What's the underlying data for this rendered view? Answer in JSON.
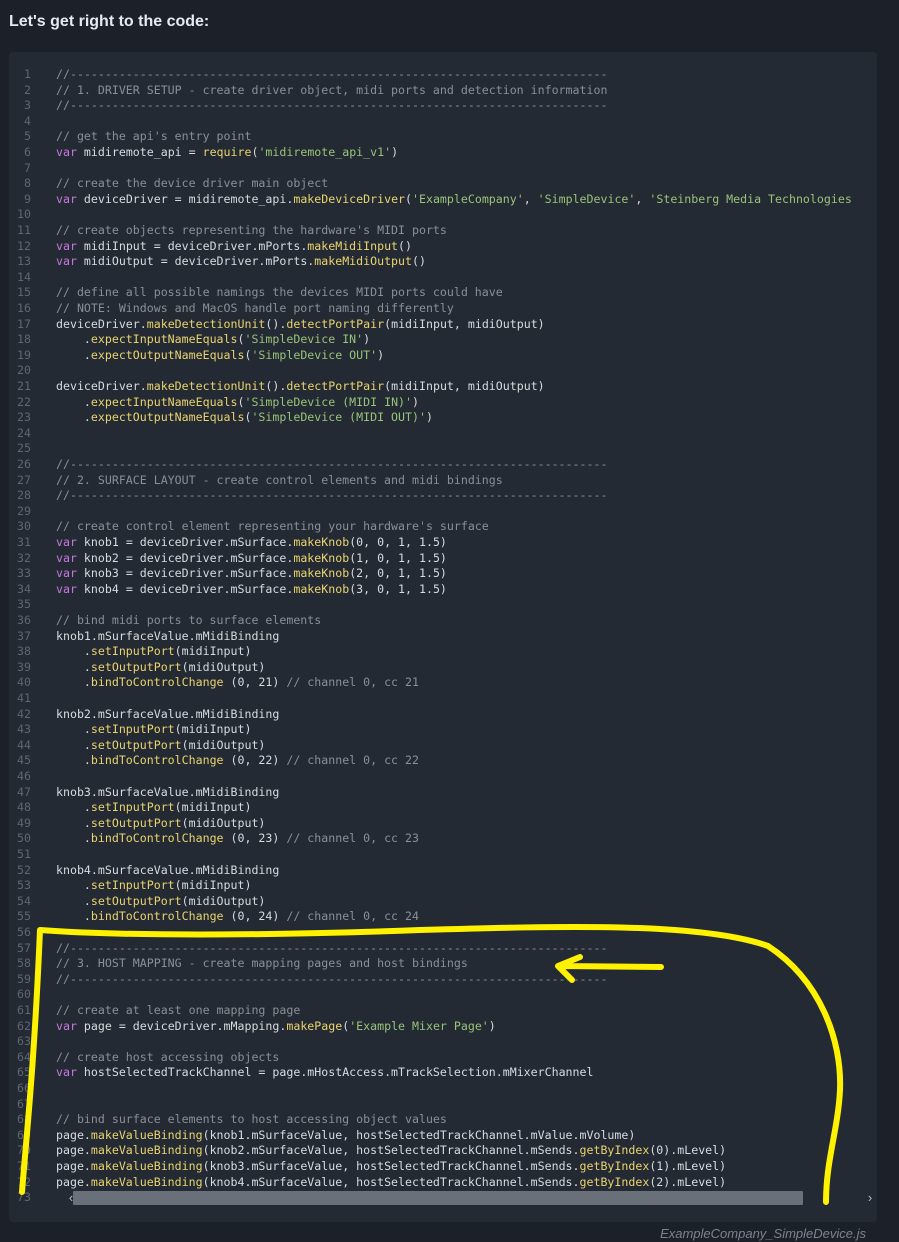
{
  "heading": "Let's get right to the code:",
  "filename": "ExampleCompany_SimpleDevice.js",
  "colors": {
    "background": "#1c2129",
    "code_background": "#242a33",
    "annotation_yellow": "#fff200"
  },
  "code": {
    "language": "javascript",
    "lines": [
      [
        {
          "t": "comment",
          "v": "//-----------------------------------------------------------------------------"
        }
      ],
      [
        {
          "t": "comment",
          "v": "// 1. DRIVER SETUP - create driver object, midi ports and detection information"
        }
      ],
      [
        {
          "t": "comment",
          "v": "//-----------------------------------------------------------------------------"
        }
      ],
      [],
      [
        {
          "t": "comment",
          "v": "// get the api's entry point"
        }
      ],
      [
        {
          "t": "keyword",
          "v": "var"
        },
        {
          "t": "plain",
          "v": " midiremote_api = "
        },
        {
          "t": "function",
          "v": "require"
        },
        {
          "t": "plain",
          "v": "("
        },
        {
          "t": "string",
          "v": "'midiremote_api_v1'"
        },
        {
          "t": "plain",
          "v": ")"
        }
      ],
      [],
      [
        {
          "t": "comment",
          "v": "// create the device driver main object"
        }
      ],
      [
        {
          "t": "keyword",
          "v": "var"
        },
        {
          "t": "plain",
          "v": " deviceDriver = midiremote_api."
        },
        {
          "t": "function",
          "v": "makeDeviceDriver"
        },
        {
          "t": "plain",
          "v": "("
        },
        {
          "t": "string",
          "v": "'ExampleCompany'"
        },
        {
          "t": "plain",
          "v": ", "
        },
        {
          "t": "string",
          "v": "'SimpleDevice'"
        },
        {
          "t": "plain",
          "v": ", "
        },
        {
          "t": "string",
          "v": "'Steinberg Media Technologies"
        }
      ],
      [],
      [
        {
          "t": "comment",
          "v": "// create objects representing the hardware's MIDI ports"
        }
      ],
      [
        {
          "t": "keyword",
          "v": "var"
        },
        {
          "t": "plain",
          "v": " midiInput = deviceDriver.mPorts."
        },
        {
          "t": "function",
          "v": "makeMidiInput"
        },
        {
          "t": "plain",
          "v": "()"
        }
      ],
      [
        {
          "t": "keyword",
          "v": "var"
        },
        {
          "t": "plain",
          "v": " midiOutput = deviceDriver.mPorts."
        },
        {
          "t": "function",
          "v": "makeMidiOutput"
        },
        {
          "t": "plain",
          "v": "()"
        }
      ],
      [],
      [
        {
          "t": "comment",
          "v": "// define all possible namings the devices MIDI ports could have"
        }
      ],
      [
        {
          "t": "comment",
          "v": "// NOTE: Windows and MacOS handle port naming differently"
        }
      ],
      [
        {
          "t": "plain",
          "v": "deviceDriver."
        },
        {
          "t": "function",
          "v": "makeDetectionUnit"
        },
        {
          "t": "plain",
          "v": "()."
        },
        {
          "t": "function",
          "v": "detectPortPair"
        },
        {
          "t": "plain",
          "v": "(midiInput, midiOutput)"
        }
      ],
      [
        {
          "t": "plain",
          "v": "    ."
        },
        {
          "t": "function",
          "v": "expectInputNameEquals"
        },
        {
          "t": "plain",
          "v": "("
        },
        {
          "t": "string",
          "v": "'SimpleDevice IN'"
        },
        {
          "t": "plain",
          "v": ")"
        }
      ],
      [
        {
          "t": "plain",
          "v": "    ."
        },
        {
          "t": "function",
          "v": "expectOutputNameEquals"
        },
        {
          "t": "plain",
          "v": "("
        },
        {
          "t": "string",
          "v": "'SimpleDevice OUT'"
        },
        {
          "t": "plain",
          "v": ")"
        }
      ],
      [],
      [
        {
          "t": "plain",
          "v": "deviceDriver."
        },
        {
          "t": "function",
          "v": "makeDetectionUnit"
        },
        {
          "t": "plain",
          "v": "()."
        },
        {
          "t": "function",
          "v": "detectPortPair"
        },
        {
          "t": "plain",
          "v": "(midiInput, midiOutput)"
        }
      ],
      [
        {
          "t": "plain",
          "v": "    ."
        },
        {
          "t": "function",
          "v": "expectInputNameEquals"
        },
        {
          "t": "plain",
          "v": "("
        },
        {
          "t": "string",
          "v": "'SimpleDevice (MIDI IN)'"
        },
        {
          "t": "plain",
          "v": ")"
        }
      ],
      [
        {
          "t": "plain",
          "v": "    ."
        },
        {
          "t": "function",
          "v": "expectOutputNameEquals"
        },
        {
          "t": "plain",
          "v": "("
        },
        {
          "t": "string",
          "v": "'SimpleDevice (MIDI OUT)'"
        },
        {
          "t": "plain",
          "v": ")"
        }
      ],
      [],
      [],
      [
        {
          "t": "comment",
          "v": "//-----------------------------------------------------------------------------"
        }
      ],
      [
        {
          "t": "comment",
          "v": "// 2. SURFACE LAYOUT - create control elements and midi bindings"
        }
      ],
      [
        {
          "t": "comment",
          "v": "//-----------------------------------------------------------------------------"
        }
      ],
      [],
      [
        {
          "t": "comment",
          "v": "// create control element representing your hardware's surface"
        }
      ],
      [
        {
          "t": "keyword",
          "v": "var"
        },
        {
          "t": "plain",
          "v": " knob1 = deviceDriver.mSurface."
        },
        {
          "t": "function",
          "v": "makeKnob"
        },
        {
          "t": "plain",
          "v": "(0, 0, 1, 1.5)"
        }
      ],
      [
        {
          "t": "keyword",
          "v": "var"
        },
        {
          "t": "plain",
          "v": " knob2 = deviceDriver.mSurface."
        },
        {
          "t": "function",
          "v": "makeKnob"
        },
        {
          "t": "plain",
          "v": "(1, 0, 1, 1.5)"
        }
      ],
      [
        {
          "t": "keyword",
          "v": "var"
        },
        {
          "t": "plain",
          "v": " knob3 = deviceDriver.mSurface."
        },
        {
          "t": "function",
          "v": "makeKnob"
        },
        {
          "t": "plain",
          "v": "(2, 0, 1, 1.5)"
        }
      ],
      [
        {
          "t": "keyword",
          "v": "var"
        },
        {
          "t": "plain",
          "v": " knob4 = deviceDriver.mSurface."
        },
        {
          "t": "function",
          "v": "makeKnob"
        },
        {
          "t": "plain",
          "v": "(3, 0, 1, 1.5)"
        }
      ],
      [],
      [
        {
          "t": "comment",
          "v": "// bind midi ports to surface elements"
        }
      ],
      [
        {
          "t": "plain",
          "v": "knob1.mSurfaceValue.mMidiBinding"
        }
      ],
      [
        {
          "t": "plain",
          "v": "    ."
        },
        {
          "t": "function",
          "v": "setInputPort"
        },
        {
          "t": "plain",
          "v": "(midiInput)"
        }
      ],
      [
        {
          "t": "plain",
          "v": "    ."
        },
        {
          "t": "function",
          "v": "setOutputPort"
        },
        {
          "t": "plain",
          "v": "(midiOutput)"
        }
      ],
      [
        {
          "t": "plain",
          "v": "    ."
        },
        {
          "t": "function",
          "v": "bindToControlChange"
        },
        {
          "t": "plain",
          "v": " (0, 21) "
        },
        {
          "t": "comment",
          "v": "// channel 0, cc 21"
        }
      ],
      [],
      [
        {
          "t": "plain",
          "v": "knob2.mSurfaceValue.mMidiBinding"
        }
      ],
      [
        {
          "t": "plain",
          "v": "    ."
        },
        {
          "t": "function",
          "v": "setInputPort"
        },
        {
          "t": "plain",
          "v": "(midiInput)"
        }
      ],
      [
        {
          "t": "plain",
          "v": "    ."
        },
        {
          "t": "function",
          "v": "setOutputPort"
        },
        {
          "t": "plain",
          "v": "(midiOutput)"
        }
      ],
      [
        {
          "t": "plain",
          "v": "    ."
        },
        {
          "t": "function",
          "v": "bindToControlChange"
        },
        {
          "t": "plain",
          "v": " (0, 22) "
        },
        {
          "t": "comment",
          "v": "// channel 0, cc 22"
        }
      ],
      [],
      [
        {
          "t": "plain",
          "v": "knob3.mSurfaceValue.mMidiBinding"
        }
      ],
      [
        {
          "t": "plain",
          "v": "    ."
        },
        {
          "t": "function",
          "v": "setInputPort"
        },
        {
          "t": "plain",
          "v": "(midiInput)"
        }
      ],
      [
        {
          "t": "plain",
          "v": "    ."
        },
        {
          "t": "function",
          "v": "setOutputPort"
        },
        {
          "t": "plain",
          "v": "(midiOutput)"
        }
      ],
      [
        {
          "t": "plain",
          "v": "    ."
        },
        {
          "t": "function",
          "v": "bindToControlChange"
        },
        {
          "t": "plain",
          "v": " (0, 23) "
        },
        {
          "t": "comment",
          "v": "// channel 0, cc 23"
        }
      ],
      [],
      [
        {
          "t": "plain",
          "v": "knob4.mSurfaceValue.mMidiBinding"
        }
      ],
      [
        {
          "t": "plain",
          "v": "    ."
        },
        {
          "t": "function",
          "v": "setInputPort"
        },
        {
          "t": "plain",
          "v": "(midiInput)"
        }
      ],
      [
        {
          "t": "plain",
          "v": "    ."
        },
        {
          "t": "function",
          "v": "setOutputPort"
        },
        {
          "t": "plain",
          "v": "(midiOutput)"
        }
      ],
      [
        {
          "t": "plain",
          "v": "    ."
        },
        {
          "t": "function",
          "v": "bindToControlChange"
        },
        {
          "t": "plain",
          "v": " (0, 24) "
        },
        {
          "t": "comment",
          "v": "// channel 0, cc 24"
        }
      ],
      [],
      [
        {
          "t": "comment",
          "v": "//-----------------------------------------------------------------------------"
        }
      ],
      [
        {
          "t": "comment",
          "v": "// 3. HOST MAPPING - create mapping pages and host bindings"
        }
      ],
      [
        {
          "t": "comment",
          "v": "//-----------------------------------------------------------------------------"
        }
      ],
      [],
      [
        {
          "t": "comment",
          "v": "// create at least one mapping page"
        }
      ],
      [
        {
          "t": "keyword",
          "v": "var"
        },
        {
          "t": "plain",
          "v": " page = deviceDriver.mMapping."
        },
        {
          "t": "function",
          "v": "makePage"
        },
        {
          "t": "plain",
          "v": "("
        },
        {
          "t": "string",
          "v": "'Example Mixer Page'"
        },
        {
          "t": "plain",
          "v": ")"
        }
      ],
      [],
      [
        {
          "t": "comment",
          "v": "// create host accessing objects"
        }
      ],
      [
        {
          "t": "keyword",
          "v": "var"
        },
        {
          "t": "plain",
          "v": " hostSelectedTrackChannel = page.mHostAccess.mTrackSelection.mMixerChannel"
        }
      ],
      [],
      [],
      [
        {
          "t": "comment",
          "v": "// bind surface elements to host accessing object values"
        }
      ],
      [
        {
          "t": "plain",
          "v": "page."
        },
        {
          "t": "function",
          "v": "makeValueBinding"
        },
        {
          "t": "plain",
          "v": "(knob1.mSurfaceValue, hostSelectedTrackChannel.mValue.mVolume)"
        }
      ],
      [
        {
          "t": "plain",
          "v": "page."
        },
        {
          "t": "function",
          "v": "makeValueBinding"
        },
        {
          "t": "plain",
          "v": "(knob2.mSurfaceValue, hostSelectedTrackChannel.mSends."
        },
        {
          "t": "function",
          "v": "getByIndex"
        },
        {
          "t": "plain",
          "v": "(0).mLevel)"
        }
      ],
      [
        {
          "t": "plain",
          "v": "page."
        },
        {
          "t": "function",
          "v": "makeValueBinding"
        },
        {
          "t": "plain",
          "v": "(knob3.mSurfaceValue, hostSelectedTrackChannel.mSends."
        },
        {
          "t": "function",
          "v": "getByIndex"
        },
        {
          "t": "plain",
          "v": "(1).mLevel)"
        }
      ],
      [
        {
          "t": "plain",
          "v": "page."
        },
        {
          "t": "function",
          "v": "makeValueBinding"
        },
        {
          "t": "plain",
          "v": "(knob4.mSurfaceValue, hostSelectedTrackChannel.mSends."
        },
        {
          "t": "function",
          "v": "getByIndex"
        },
        {
          "t": "plain",
          "v": "(2).mLevel)"
        }
      ],
      []
    ]
  },
  "scrollbar": {
    "left_glyph": "‹",
    "right_glyph": "›"
  }
}
